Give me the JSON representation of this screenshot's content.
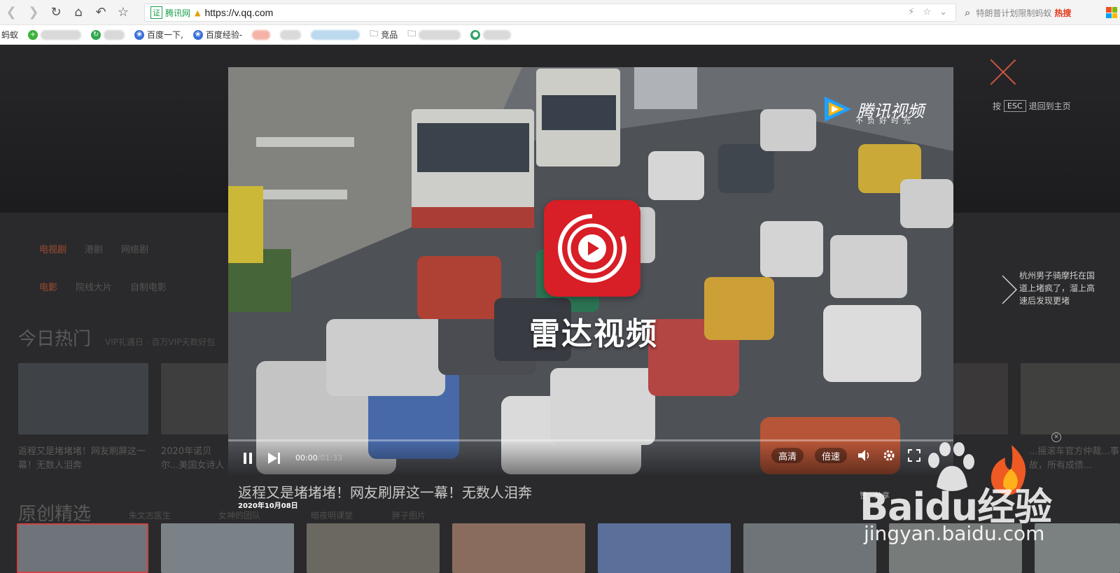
{
  "browser": {
    "cert_label": "腾讯网",
    "url": "https://v.qq.com",
    "search_text": "特朗普计划限制蚂蚁",
    "search_hot": "热搜"
  },
  "bookmarks": [
    {
      "label": "蚂蚁"
    },
    {
      "label": "百度一下,"
    },
    {
      "label": "百度经验-"
    },
    {
      "label": "竞品"
    }
  ],
  "page": {
    "categories_row1": {
      "main": "电视剧",
      "items": [
        "港剧",
        "网络剧"
      ]
    },
    "categories_row2": {
      "main": "电影",
      "items": [
        "院线大片",
        "自制电影"
      ]
    },
    "hot_title": "今日热门",
    "hot_sub": "VIP礼遇日 · 百万VIP天数好包",
    "hot_items": [
      {
        "caption": "返程又是堵堵堵！网友刷屏这一幕！无数人泪奔",
        "duration": "01:33"
      },
      {
        "caption": "2020年诺贝尔...美国女诗人格..."
      },
      {
        "caption": "...摇滚车官方仲裁...事故，所有成债..."
      }
    ],
    "original_title": "原创精选",
    "original_tags": [
      "朱文志医生",
      "女神的团队",
      "暗夜明课堂",
      "胖子图片"
    ]
  },
  "overlay": {
    "esc_prefix": "按",
    "esc_key": "ESC",
    "esc_suffix": "退回到主页",
    "next_title": "杭州男子骑摩托在国道上堵疯了，溜上高速后发现更堵"
  },
  "player": {
    "brand_name": "腾讯视频",
    "brand_slogan": "不负好时光",
    "radar_text": "雷达视频",
    "current_time": "00:00",
    "total_time": "/01:33",
    "quality_label": "高清",
    "speed_label": "倍速",
    "progress": 0,
    "video_title": "返程又是堵堵堵！网友刷屏这一幕！无数人泪奔",
    "video_date": "2020年10月08日",
    "actions": [
      "赞",
      "分享"
    ]
  },
  "watermark": {
    "bai": "Baidu经验",
    "url": "jingyan.baidu.com"
  }
}
